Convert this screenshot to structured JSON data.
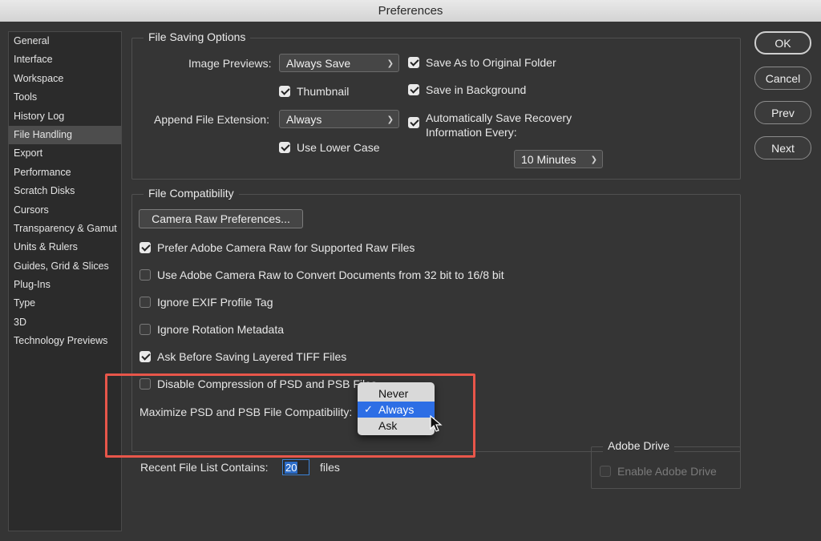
{
  "window": {
    "title": "Preferences"
  },
  "sidebar": {
    "items": [
      {
        "label": "General"
      },
      {
        "label": "Interface"
      },
      {
        "label": "Workspace"
      },
      {
        "label": "Tools"
      },
      {
        "label": "History Log"
      },
      {
        "label": "File Handling",
        "selected": true
      },
      {
        "label": "Export"
      },
      {
        "label": "Performance"
      },
      {
        "label": "Scratch Disks"
      },
      {
        "label": "Cursors"
      },
      {
        "label": "Transparency & Gamut"
      },
      {
        "label": "Units & Rulers"
      },
      {
        "label": "Guides, Grid & Slices"
      },
      {
        "label": "Plug-Ins"
      },
      {
        "label": "Type"
      },
      {
        "label": "3D"
      },
      {
        "label": "Technology Previews"
      }
    ]
  },
  "file_saving": {
    "title": "File Saving Options",
    "image_previews_label": "Image Previews:",
    "image_previews_value": "Always Save",
    "thumbnail_label": "Thumbnail",
    "thumbnail_checked": true,
    "append_ext_label": "Append File Extension:",
    "append_ext_value": "Always",
    "lower_case_label": "Use Lower Case",
    "lower_case_checked": true,
    "save_as_original_label": "Save As to Original Folder",
    "save_as_original_checked": true,
    "save_background_label": "Save in Background",
    "save_background_checked": true,
    "auto_save_label_1": "Automatically Save Recovery",
    "auto_save_label_2": "Information Every:",
    "auto_save_checked": true,
    "auto_save_interval": "10 Minutes"
  },
  "file_compat": {
    "title": "File Compatibility",
    "camera_raw_button": "Camera Raw Preferences...",
    "options": [
      {
        "label": "Prefer Adobe Camera Raw for Supported Raw Files",
        "checked": true
      },
      {
        "label": "Use Adobe Camera Raw to Convert Documents from 32 bit to 16/8 bit",
        "checked": false
      },
      {
        "label": "Ignore EXIF Profile Tag",
        "checked": false
      },
      {
        "label": "Ignore Rotation Metadata",
        "checked": false
      },
      {
        "label": "Ask Before Saving Layered TIFF Files",
        "checked": true
      },
      {
        "label": "Disable Compression of PSD and PSB Files",
        "checked": false
      }
    ],
    "maximize_label": "Maximize PSD and PSB File Compatibility:",
    "maximize_menu": [
      {
        "label": "Never"
      },
      {
        "label": "Always",
        "selected": true
      },
      {
        "label": "Ask"
      }
    ]
  },
  "recent": {
    "label": "Recent File List Contains:",
    "value": "20",
    "suffix": "files"
  },
  "adobe_drive": {
    "title": "Adobe Drive",
    "enable_label": "Enable Adobe Drive",
    "checked": false,
    "disabled": true
  },
  "buttons": {
    "ok": "OK",
    "cancel": "Cancel",
    "prev": "Prev",
    "next": "Next"
  },
  "colors": {
    "highlight": "#e8564a",
    "menu_selection": "#2d6ee5"
  }
}
